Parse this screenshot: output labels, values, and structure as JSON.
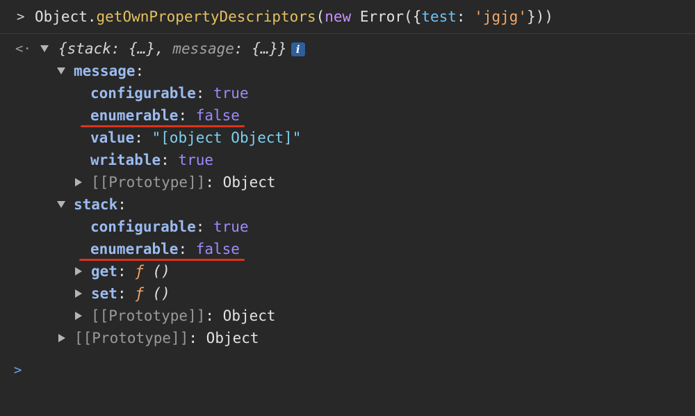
{
  "input": {
    "prompt": ">",
    "obj": "Object",
    "dot": ".",
    "method": "getOwnPropertyDescriptors",
    "open": "(",
    "kw_new": "new",
    "ctor": " Error({",
    "prop": "test",
    "colon": ": ",
    "str": "'jgjg'",
    "close": "}))"
  },
  "result": {
    "prompt": "<·",
    "summary_open": "{",
    "summary_k1": "stack",
    "summary_v1": ": {…}, ",
    "summary_k2": "message",
    "summary_v2": ": {…}}",
    "info": "i"
  },
  "message": {
    "key": "message",
    "colon": ":",
    "configurable_key": "configurable",
    "configurable_val": "true",
    "enumerable_key": "enumerable",
    "enumerable_val": "false",
    "value_key": "value",
    "value_val": "\"[object Object]\"",
    "writable_key": "writable",
    "writable_val": "true",
    "proto_key": "[[Prototype]]",
    "proto_val": "Object"
  },
  "stack": {
    "key": "stack",
    "colon": ":",
    "configurable_key": "configurable",
    "configurable_val": "true",
    "enumerable_key": "enumerable",
    "enumerable_val": "false",
    "get_key": "get",
    "set_key": "set",
    "fn_f": "ƒ",
    "fn_args": " ()",
    "proto_key": "[[Prototype]]",
    "proto_val": "Object"
  },
  "root_proto": {
    "key": "[[Prototype]]",
    "val": "Object"
  },
  "bottom_prompt": ">",
  "colors": {
    "background": "#282828",
    "key": "#9bbbf0",
    "boolean": "#9b8cff",
    "string": "#7fd0f0",
    "underline": "#e0321c"
  }
}
